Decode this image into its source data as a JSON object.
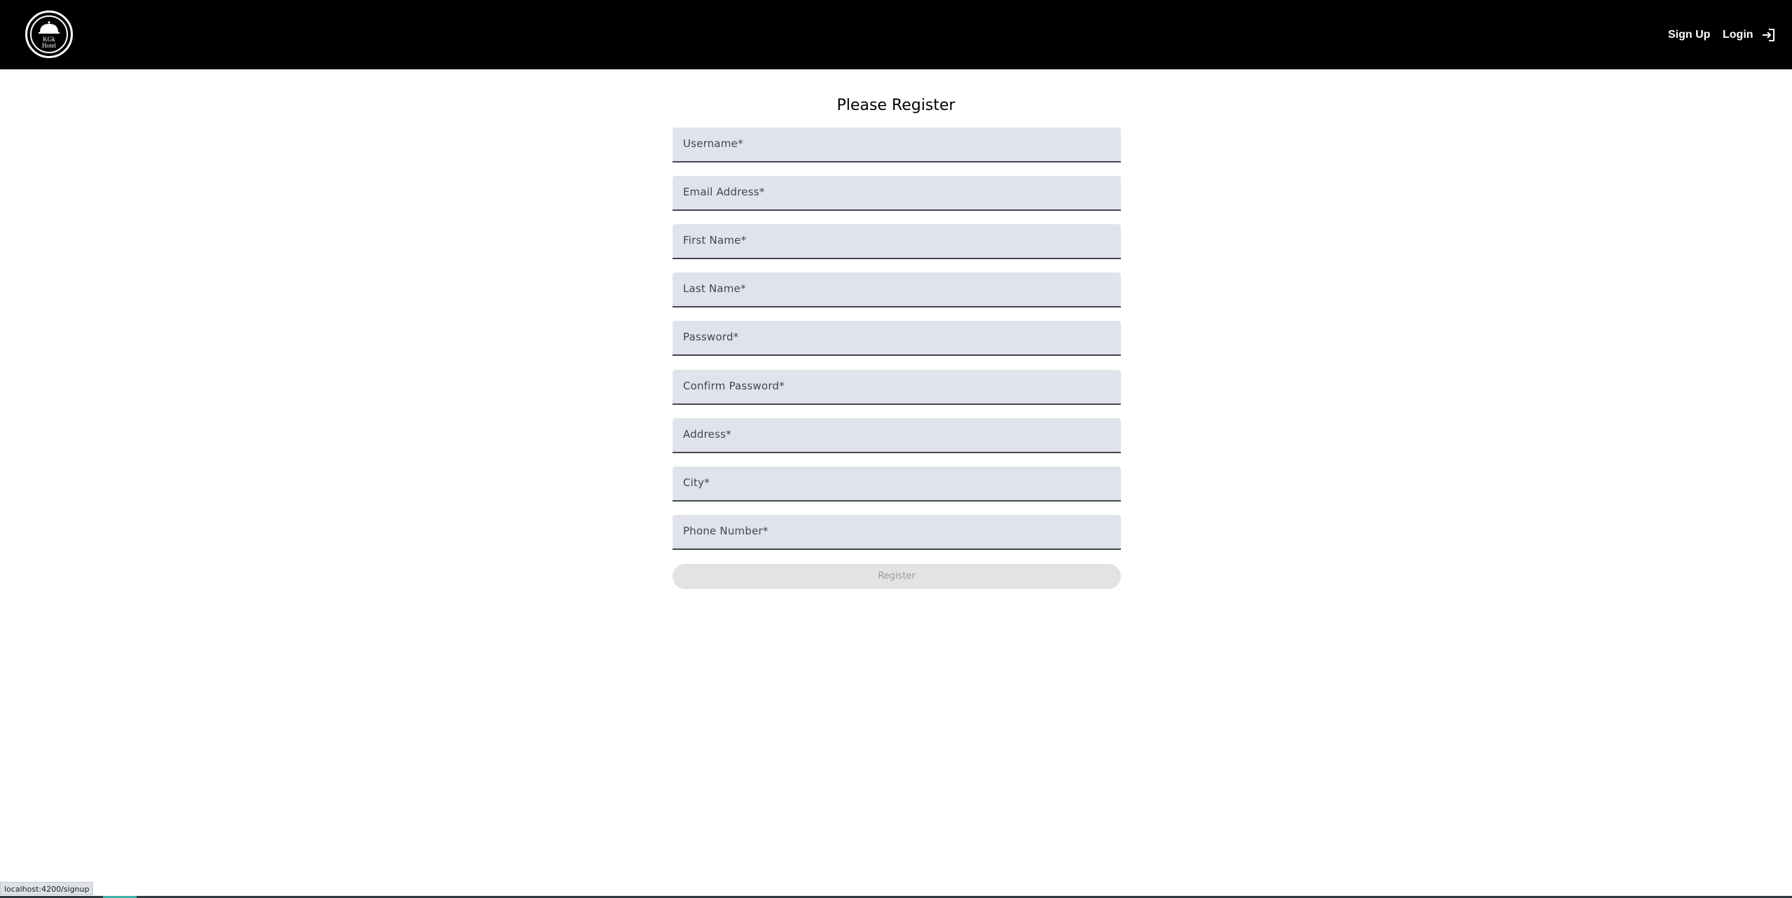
{
  "nav": {
    "logo_text_line1": "KGk",
    "logo_text_line2": "Hotel",
    "signup_label": "Sign Up",
    "login_label": "Login"
  },
  "form": {
    "title": "Please Register",
    "fields": [
      {
        "label": "Username*"
      },
      {
        "label": "Email Address*"
      },
      {
        "label": "First Name*"
      },
      {
        "label": "Last Name*"
      },
      {
        "label": "Password*"
      },
      {
        "label": "Confirm Password*"
      },
      {
        "label": "Address*"
      },
      {
        "label": "City*"
      },
      {
        "label": "Phone Number*"
      }
    ],
    "submit_label": "Register"
  },
  "status_bar": {
    "url": "localhost:4200/signup"
  },
  "colors": {
    "navbar_bg": "#000000",
    "field_bg": "#e1e3ec",
    "button_disabled_bg": "#e3e3e4"
  },
  "icons": {
    "logo": "hotel-bell-icon",
    "login": "login-icon"
  }
}
